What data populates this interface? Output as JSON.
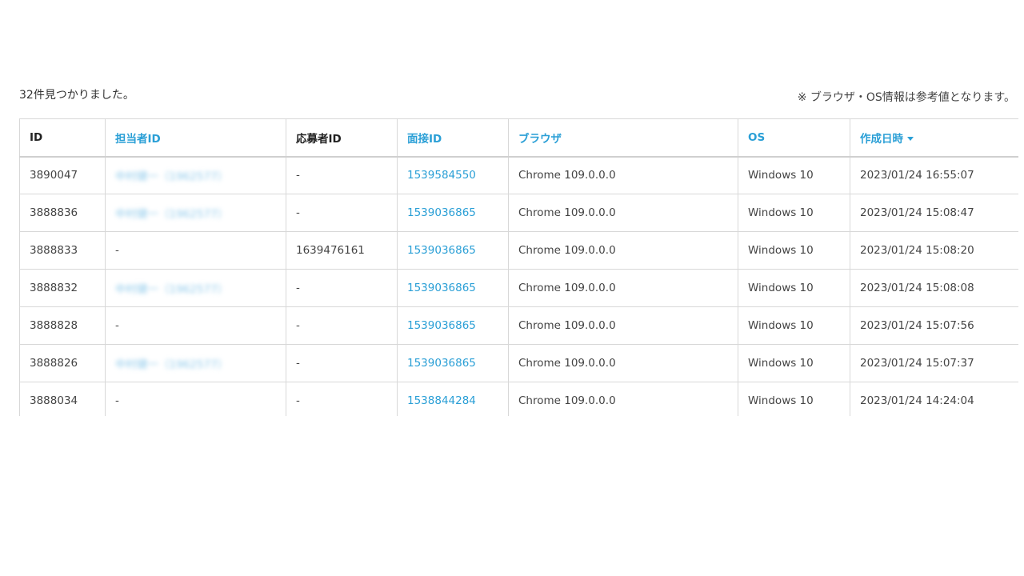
{
  "summary": {
    "count_text": "32件見つかりました。",
    "note_text": "※ ブラウザ・OS情報は参考値となります。"
  },
  "table": {
    "headers": {
      "id": "ID",
      "staff_id": "担当者ID",
      "applicant_id": "応募者ID",
      "interview_id": "面接ID",
      "browser": "ブラウザ",
      "os": "OS",
      "created_at": "作成日時"
    },
    "sorted_column": "created_at",
    "sort_direction": "descending",
    "colors": {
      "link": "#2a9fd6",
      "border": "#d8d8d8"
    },
    "rows": [
      {
        "id": "3890047",
        "staff_id": "中村健一（1962577）",
        "applicant_id": "-",
        "interview_id": "1539584550",
        "browser": "Chrome 109.0.0.0",
        "os": "Windows 10",
        "created_at": "2023/01/24 16:55:07"
      },
      {
        "id": "3888836",
        "staff_id": "中村健一（1962577）",
        "applicant_id": "-",
        "interview_id": "1539036865",
        "browser": "Chrome 109.0.0.0",
        "os": "Windows 10",
        "created_at": "2023/01/24 15:08:47"
      },
      {
        "id": "3888833",
        "staff_id": "-",
        "applicant_id": "1639476161",
        "interview_id": "1539036865",
        "browser": "Chrome 109.0.0.0",
        "os": "Windows 10",
        "created_at": "2023/01/24 15:08:20"
      },
      {
        "id": "3888832",
        "staff_id": "中村健一（1962577）",
        "applicant_id": "-",
        "interview_id": "1539036865",
        "browser": "Chrome 109.0.0.0",
        "os": "Windows 10",
        "created_at": "2023/01/24 15:08:08"
      },
      {
        "id": "3888828",
        "staff_id": "-",
        "applicant_id": "-",
        "interview_id": "1539036865",
        "browser": "Chrome 109.0.0.0",
        "os": "Windows 10",
        "created_at": "2023/01/24 15:07:56"
      },
      {
        "id": "3888826",
        "staff_id": "中村健一（1962577）",
        "applicant_id": "-",
        "interview_id": "1539036865",
        "browser": "Chrome 109.0.0.0",
        "os": "Windows 10",
        "created_at": "2023/01/24 15:07:37"
      },
      {
        "id": "3888034",
        "staff_id": "-",
        "applicant_id": "-",
        "interview_id": "1538844284",
        "browser": "Chrome 109.0.0.0",
        "os": "Windows 10",
        "created_at": "2023/01/24 14:24:04"
      }
    ]
  }
}
